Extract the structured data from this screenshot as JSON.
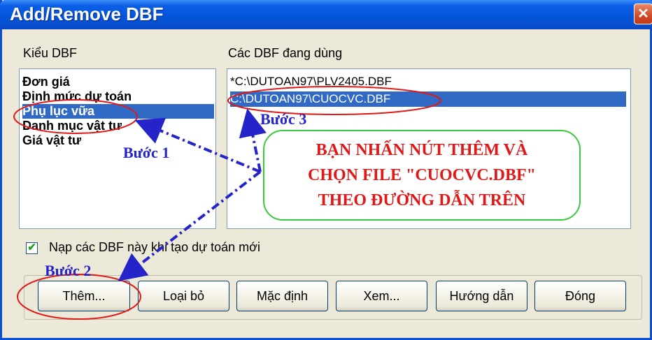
{
  "window": {
    "title": "Add/Remove DBF",
    "close_label": "✕"
  },
  "left_panel": {
    "label": "Kiểu DBF",
    "items": [
      "Đơn giá",
      "Định mức dự toán",
      "Phụ lục vữa",
      "Danh mục vật tư",
      "Giá vật tư"
    ],
    "selected_index": 2
  },
  "right_panel": {
    "label": "Các DBF đang dùng",
    "items": [
      "*C:\\DUTOAN97\\PLV2405.DBF",
      "C:\\DUTOAN97\\CUOCVC.DBF"
    ],
    "selected_index": 1
  },
  "checkbox": {
    "label": "Nạp các DBF này khi tạo dự toán mới",
    "checked": true
  },
  "buttons": {
    "add": "Thêm...",
    "remove": "Loại bỏ",
    "default": "Mặc định",
    "view": "Xem...",
    "help": "Hướng dẫn",
    "close": "Đóng"
  },
  "annotations": {
    "step1": "Bước 1",
    "step2": "Bước 2",
    "step3": "Bước 3",
    "callout": [
      "BẠN NHẤN NÚT THÊM VÀ",
      "CHỌN FILE \"CUOCVC.DBF\"",
      "THEO ĐƯỜNG DẪN TRÊN"
    ]
  },
  "colors": {
    "titlebar": "#0454d9",
    "selection": "#316ac5",
    "annotation_blue": "#2424c8",
    "annotation_red": "#e01818",
    "callout_border": "#3cc83c"
  }
}
